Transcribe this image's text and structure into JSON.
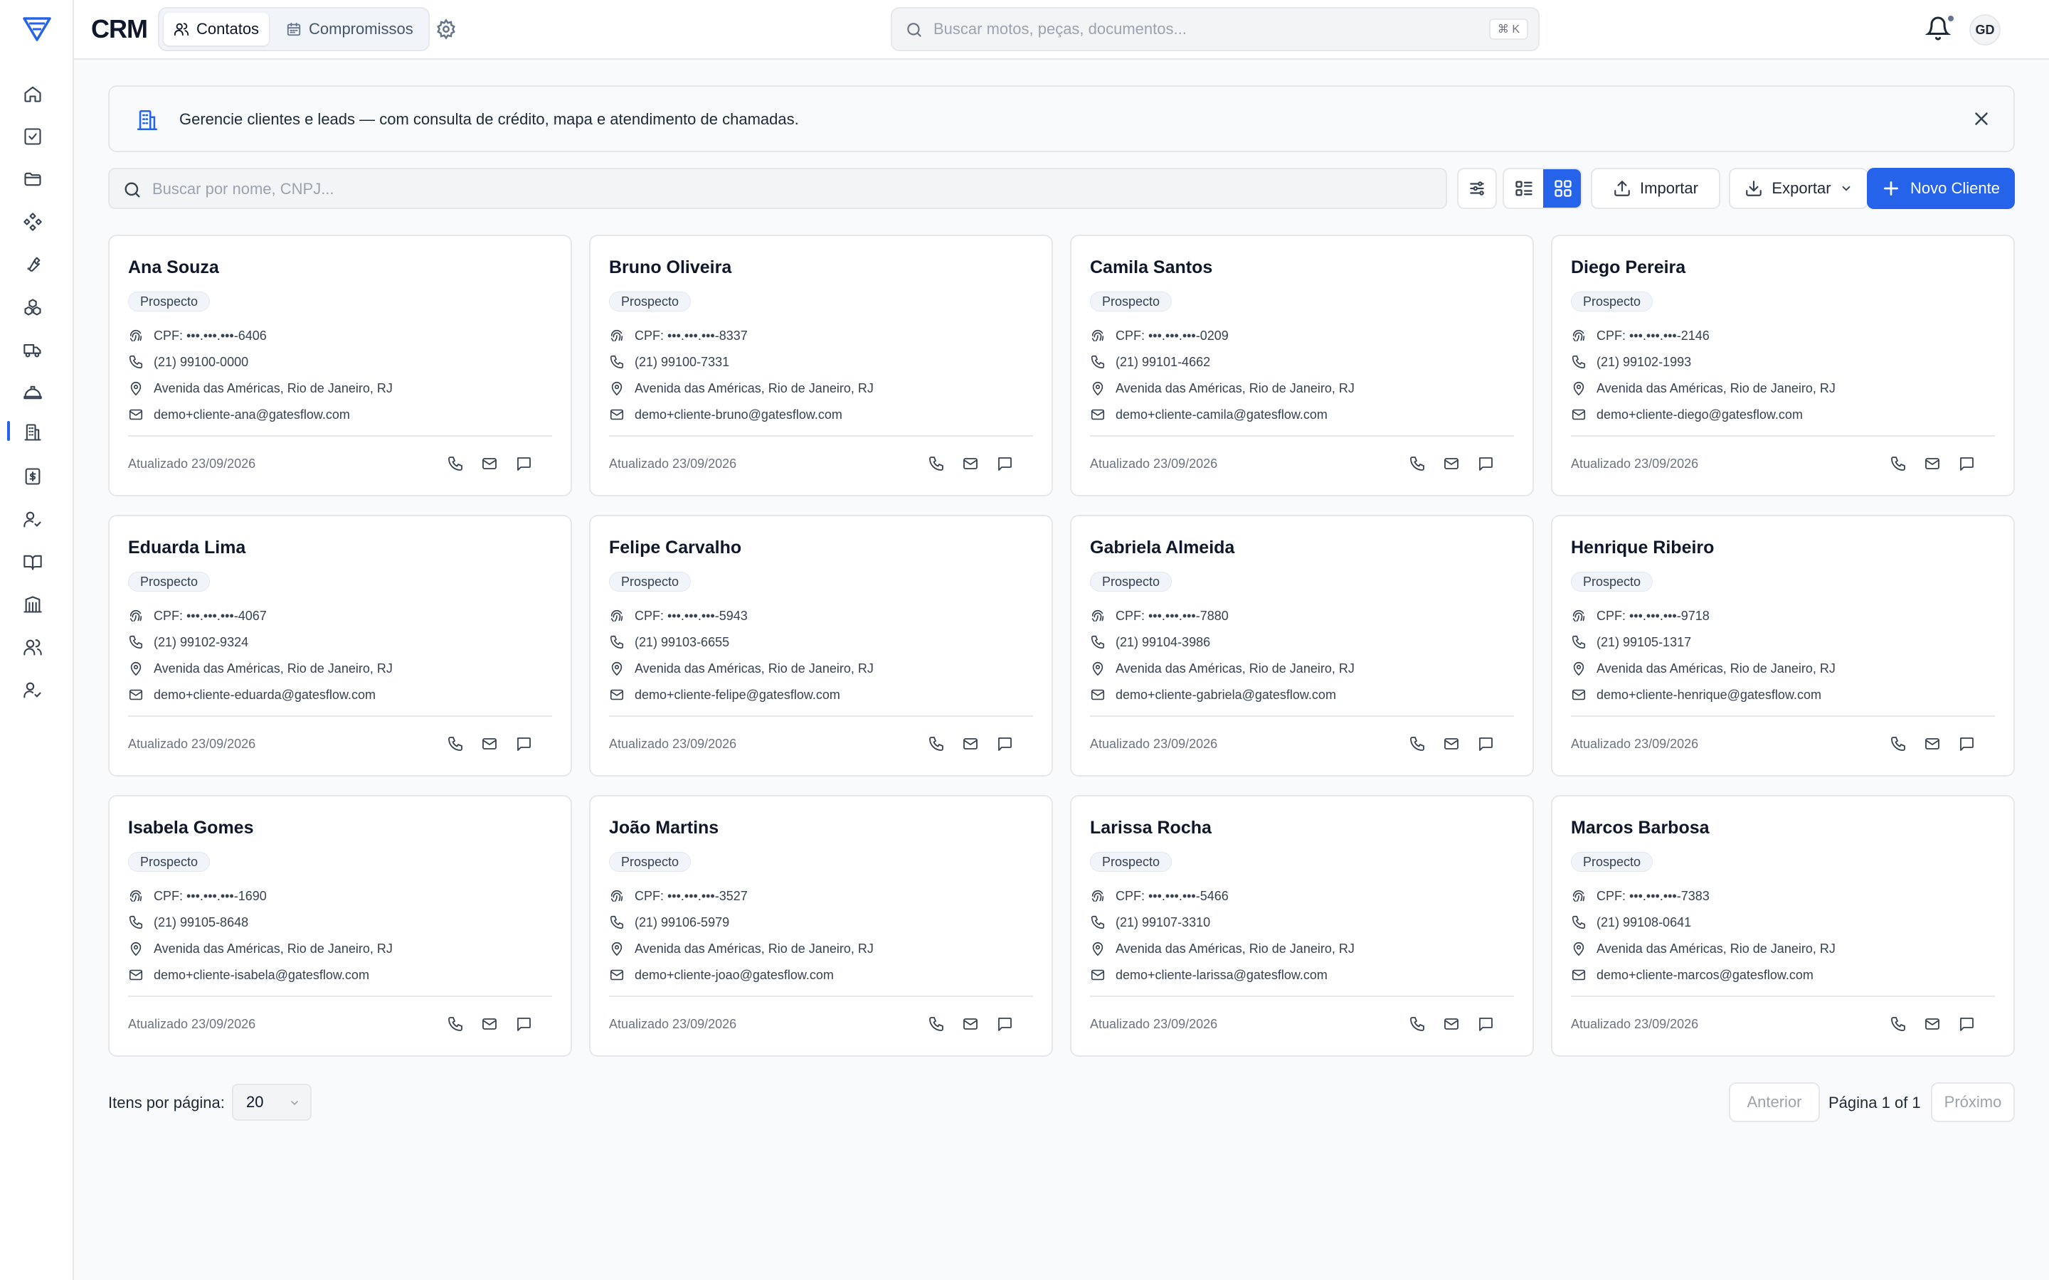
{
  "app": {
    "title": "CRM"
  },
  "topbar": {
    "tabs": [
      {
        "label": "Contatos",
        "icon": "users-icon",
        "active": true
      },
      {
        "label": "Compromissos",
        "icon": "calendar-icon",
        "active": false
      }
    ],
    "search_placeholder": "Buscar motos, peças, documentos...",
    "search_shortcut": "⌘ K",
    "avatar_initials": "GD"
  },
  "sidebar": {
    "items": [
      {
        "icon": "home-icon"
      },
      {
        "icon": "check-square-icon"
      },
      {
        "icon": "folder-icon"
      },
      {
        "icon": "diamond-grid-icon"
      },
      {
        "icon": "wrench-icon"
      },
      {
        "icon": "boxes-icon"
      },
      {
        "icon": "truck-icon"
      },
      {
        "icon": "helmet-icon"
      },
      {
        "icon": "building-icon",
        "active": true
      },
      {
        "icon": "receipt-icon"
      },
      {
        "icon": "user-check-icon"
      },
      {
        "icon": "book-icon"
      },
      {
        "icon": "library-icon"
      },
      {
        "icon": "team-icon"
      },
      {
        "icon": "user-check-icon"
      }
    ]
  },
  "banner": {
    "text": "Gerencie clientes e leads — com consulta de crédito, mapa e atendimento de chamadas."
  },
  "toolbar": {
    "search_placeholder": "Buscar por nome, CNPJ...",
    "import_label": "Importar",
    "export_label": "Exportar",
    "new_label": "Novo Cliente",
    "view_mode": "grid"
  },
  "contacts": [
    {
      "name": "Ana Souza",
      "status": "Prospecto",
      "cpf": "CPF: •••.•••.•••-6406",
      "phone": "(21) 99100-0000",
      "address": "Avenida das Américas, Rio de Janeiro, RJ",
      "email": "demo+cliente-ana@gatesflow.com",
      "updated": "Atualizado 23/09/2026"
    },
    {
      "name": "Bruno Oliveira",
      "status": "Prospecto",
      "cpf": "CPF: •••.•••.•••-8337",
      "phone": "(21) 99100-7331",
      "address": "Avenida das Américas, Rio de Janeiro, RJ",
      "email": "demo+cliente-bruno@gatesflow.com",
      "updated": "Atualizado 23/09/2026"
    },
    {
      "name": "Camila Santos",
      "status": "Prospecto",
      "cpf": "CPF: •••.•••.•••-0209",
      "phone": "(21) 99101-4662",
      "address": "Avenida das Américas, Rio de Janeiro, RJ",
      "email": "demo+cliente-camila@gatesflow.com",
      "updated": "Atualizado 23/09/2026"
    },
    {
      "name": "Diego Pereira",
      "status": "Prospecto",
      "cpf": "CPF: •••.•••.•••-2146",
      "phone": "(21) 99102-1993",
      "address": "Avenida das Américas, Rio de Janeiro, RJ",
      "email": "demo+cliente-diego@gatesflow.com",
      "updated": "Atualizado 23/09/2026"
    },
    {
      "name": "Eduarda Lima",
      "status": "Prospecto",
      "cpf": "CPF: •••.•••.•••-4067",
      "phone": "(21) 99102-9324",
      "address": "Avenida das Américas, Rio de Janeiro, RJ",
      "email": "demo+cliente-eduarda@gatesflow.com",
      "updated": "Atualizado 23/09/2026"
    },
    {
      "name": "Felipe Carvalho",
      "status": "Prospecto",
      "cpf": "CPF: •••.•••.•••-5943",
      "phone": "(21) 99103-6655",
      "address": "Avenida das Américas, Rio de Janeiro, RJ",
      "email": "demo+cliente-felipe@gatesflow.com",
      "updated": "Atualizado 23/09/2026"
    },
    {
      "name": "Gabriela Almeida",
      "status": "Prospecto",
      "cpf": "CPF: •••.•••.•••-7880",
      "phone": "(21) 99104-3986",
      "address": "Avenida das Américas, Rio de Janeiro, RJ",
      "email": "demo+cliente-gabriela@gatesflow.com",
      "updated": "Atualizado 23/09/2026"
    },
    {
      "name": "Henrique Ribeiro",
      "status": "Prospecto",
      "cpf": "CPF: •••.•••.•••-9718",
      "phone": "(21) 99105-1317",
      "address": "Avenida das Américas, Rio de Janeiro, RJ",
      "email": "demo+cliente-henrique@gatesflow.com",
      "updated": "Atualizado 23/09/2026"
    },
    {
      "name": "Isabela Gomes",
      "status": "Prospecto",
      "cpf": "CPF: •••.•••.•••-1690",
      "phone": "(21) 99105-8648",
      "address": "Avenida das Américas, Rio de Janeiro, RJ",
      "email": "demo+cliente-isabela@gatesflow.com",
      "updated": "Atualizado 23/09/2026"
    },
    {
      "name": "João Martins",
      "status": "Prospecto",
      "cpf": "CPF: •••.•••.•••-3527",
      "phone": "(21) 99106-5979",
      "address": "Avenida das Américas, Rio de Janeiro, RJ",
      "email": "demo+cliente-joao@gatesflow.com",
      "updated": "Atualizado 23/09/2026"
    },
    {
      "name": "Larissa Rocha",
      "status": "Prospecto",
      "cpf": "CPF: •••.•••.•••-5466",
      "phone": "(21) 99107-3310",
      "address": "Avenida das Américas, Rio de Janeiro, RJ",
      "email": "demo+cliente-larissa@gatesflow.com",
      "updated": "Atualizado 23/09/2026"
    },
    {
      "name": "Marcos Barbosa",
      "status": "Prospecto",
      "cpf": "CPF: •••.•••.•••-7383",
      "phone": "(21) 99108-0641",
      "address": "Avenida das Américas, Rio de Janeiro, RJ",
      "email": "demo+cliente-marcos@gatesflow.com",
      "updated": "Atualizado 23/09/2026"
    }
  ],
  "pagination": {
    "per_page_label": "Itens por página:",
    "per_page_value": "20",
    "prev_label": "Anterior",
    "next_label": "Próximo",
    "page_info": "Página 1 of 1"
  },
  "colors": {
    "accent": "#2563eb",
    "border": "#e5e7eb",
    "muted": "#6b7280"
  }
}
